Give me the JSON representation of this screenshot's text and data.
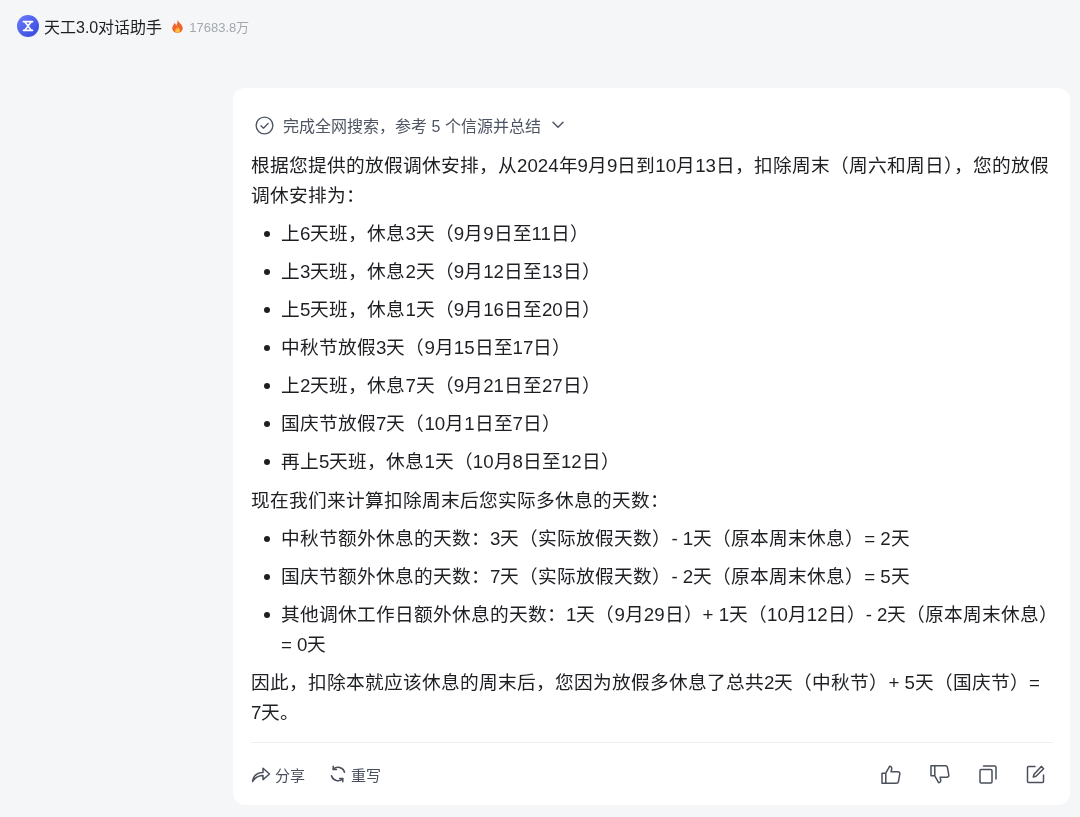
{
  "header": {
    "title": "天工3.0对话助手",
    "count": "17683.8万"
  },
  "answer": {
    "search_status": {
      "text": "完成全网搜索，参考 5 个信源并总结",
      "expanded": false
    },
    "blocks": [
      {
        "kind": "paragraph",
        "text": "根据您提供的放假调休安排，从2024年9月9日到10月13日，扣除周末（周六和周日），您的放假调休安排为："
      },
      {
        "kind": "bullet_list",
        "items": [
          "上6天班，休息3天（9月9日至11日）",
          "上3天班，休息2天（9月12日至13日）",
          "上5天班，休息1天（9月16日至20日）",
          "中秋节放假3天（9月15日至17日）",
          "上2天班，休息7天（9月21日至27日）",
          "国庆节放假7天（10月1日至7日）",
          "再上5天班，休息1天（10月8日至12日）"
        ]
      },
      {
        "kind": "paragraph",
        "text": "现在我们来计算扣除周末后您实际多休息的天数："
      },
      {
        "kind": "bullet_list",
        "items": [
          "中秋节额外休息的天数：3天（实际放假天数）- 1天（原本周末休息）= 2天",
          "国庆节额外休息的天数：7天（实际放假天数）- 2天（原本周末休息）= 5天",
          "其他调休工作日额外休息的天数：1天（9月29日）+ 1天（10月12日）- 2天（原本周末休息）= 0天"
        ]
      },
      {
        "kind": "paragraph",
        "text": "因此，扣除本就应该休息的周末后，您因为放假多休息了总共2天（中秋节）+ 5天（国庆节）= 7天。"
      }
    ],
    "actions": [
      {
        "kind": "share",
        "label": "分享"
      },
      {
        "kind": "rewrite",
        "label": "重写"
      }
    ]
  }
}
